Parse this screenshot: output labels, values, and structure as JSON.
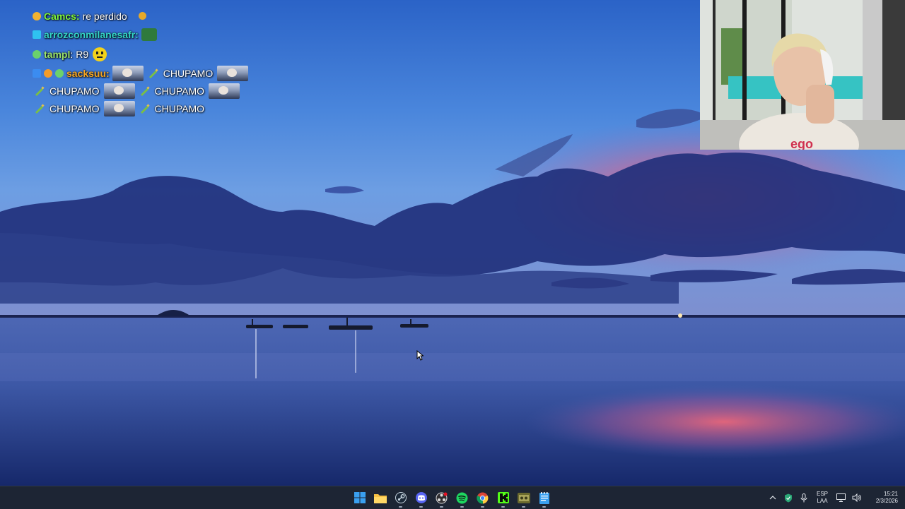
{
  "chat": {
    "lines": [
      {
        "user": "Camcs",
        "sep": ":",
        "message": "re perdido",
        "user_color": "#7ff53d"
      },
      {
        "user": "arrozconmilanesafr",
        "sep": ":",
        "message": "",
        "user_color": "#34d6c8"
      },
      {
        "user": "tampl",
        "sep": ":",
        "message": "R9",
        "user_color": "#9be36c"
      },
      {
        "user": "sacksuu",
        "sep": ":",
        "message": "CHUPAMO",
        "user_color": "#f5a623"
      }
    ],
    "emote_lines": [
      [
        "CHUPAMO",
        "CHUPAMO"
      ],
      [
        "CHUPAMO",
        "CHUPAMO"
      ]
    ]
  },
  "taskbar": {
    "apps": [
      {
        "name": "windows-start",
        "icon": "windows-icon"
      },
      {
        "name": "file-explorer",
        "icon": "folder-icon"
      },
      {
        "name": "steam",
        "icon": "steam-icon"
      },
      {
        "name": "discord",
        "icon": "discord-icon"
      },
      {
        "name": "obs",
        "icon": "obs-icon"
      },
      {
        "name": "spotify",
        "icon": "spotify-icon"
      },
      {
        "name": "chrome",
        "icon": "chrome-icon"
      },
      {
        "name": "kick",
        "icon": "kick-icon"
      },
      {
        "name": "game-app",
        "icon": "game-icon"
      },
      {
        "name": "notepad",
        "icon": "notepad-icon"
      }
    ],
    "tray": {
      "lang_top": "ESP",
      "lang_bottom": "LAA",
      "time": "15:21",
      "date": "2/3/2026"
    }
  },
  "colors": {
    "taskbar_bg": "#1d2534",
    "accent_windows": "#3aa0f0"
  }
}
